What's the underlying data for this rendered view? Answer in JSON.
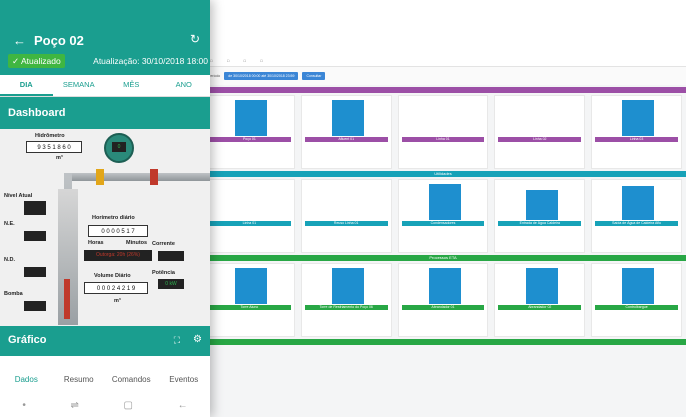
{
  "app": {
    "title": "Poço 02",
    "status_badge": "✓ Atualizado",
    "updated": "Atualização: 30/10/2018 18:00"
  },
  "tabs": [
    "DIA",
    "SEMANA",
    "MÊS",
    "ANO"
  ],
  "dashboard": {
    "title": "Dashboard",
    "hidrometro_label": "Hidrômetro",
    "hidrometro_digits": "9 3 5 1 8 6 0",
    "hidrometro_unit": "m³",
    "display_value": "0",
    "nivel_atual": "Nível Atual",
    "ne": "N.E.",
    "nd": "N.D.",
    "bomba": "Bomba",
    "horimetro_title": "Horímetro diário",
    "horimetro_digits": "0 0 0 0 5 1 7",
    "horas": "Horas",
    "minutos": "Minutos",
    "outorga": "Outorga: 20h (26%)",
    "corrente": "Corrente",
    "potencia": "Potência",
    "potencia_value": "0 kW",
    "volume_title": "Volume Diário",
    "volume_digits": "0 0 0 2 4 2 1 9",
    "volume_unit": "m³"
  },
  "grafico": {
    "title": "Gráfico"
  },
  "bottom_nav": [
    "Dados",
    "Resumo",
    "Comandos",
    "Eventos"
  ],
  "desktop": {
    "filter_button": "de 30/10/2018 00:00 até 30/10/2018 23:59",
    "filter_label": "Período",
    "consultar": "Consultar",
    "sections": [
      {
        "label": "Utilidades",
        "color": "#17a2b8"
      },
      {
        "label": "Processos ETA",
        "color": "#28a745"
      }
    ],
    "row1_labels": [
      "Poço 01",
      "Afluent 01",
      "Linha 01",
      "Linha 02",
      "Linha 03"
    ],
    "row2_labels": [
      "Linha 01",
      "Reuso Linha 01",
      "Condensadores",
      "Entrada de Água Caldeira",
      "Saída de Água de Caldeira Aflu"
    ],
    "row3_labels": [
      "Torre Aluno",
      "Torre de Resfriamento do Poço 06",
      "Abrandador 01",
      "Abrandador 02",
      "Controlbargue"
    ]
  },
  "colors": {
    "primary": "#1a9e8f",
    "badge": "#3fb641"
  }
}
